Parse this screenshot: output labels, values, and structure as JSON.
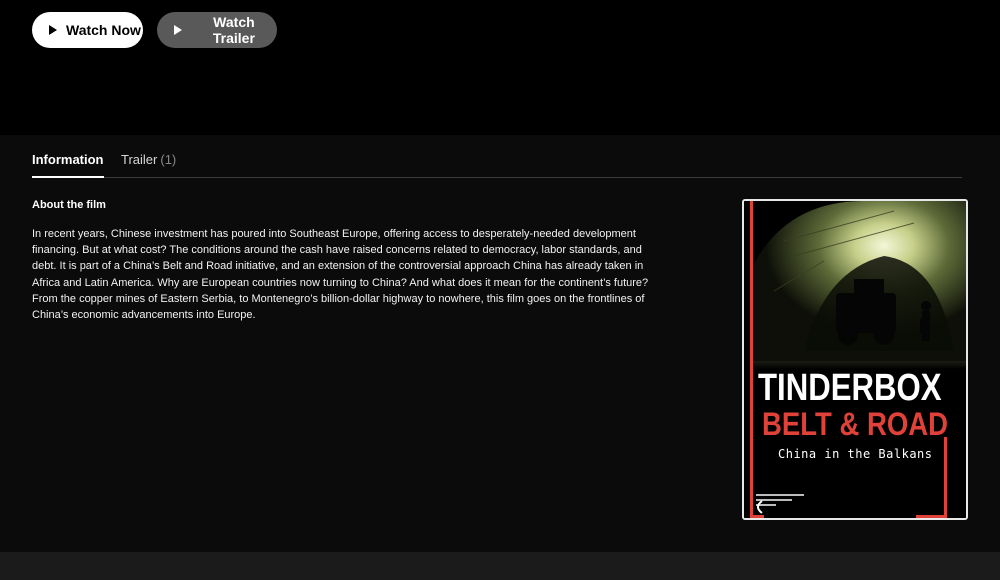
{
  "hero": {
    "watch_now_label": "Watch Now",
    "watch_trailer_label": "Watch Trailer"
  },
  "tabs": [
    {
      "label": "Information",
      "active": true
    },
    {
      "label": "Trailer",
      "count": "(1)"
    }
  ],
  "about": {
    "title": "About the film",
    "body": "In recent years, Chinese investment has poured into Southeast Europe, offering access to desperately-needed development financing. But at what cost? The conditions around the cash have raised concerns related to democracy, labor standards, and debt. It is part of a China’s Belt and Road initiative, and an extension of the controversial approach China has already taken in Africa and Latin America. Why are European countries now turning to China? And what does it mean for the continent’s future? From the copper mines of Eastern Serbia, to Montenegro’s billion-dollar highway to nowhere, this film goes on the frontlines of China’s economic advancements into Europe."
  },
  "poster": {
    "title_line1": "TINDERBOX",
    "title_line2": "BELT & ROAD",
    "subtitle": "China in the Balkans",
    "accent_color": "#e0423a"
  },
  "icons": {
    "play": "play-icon"
  }
}
